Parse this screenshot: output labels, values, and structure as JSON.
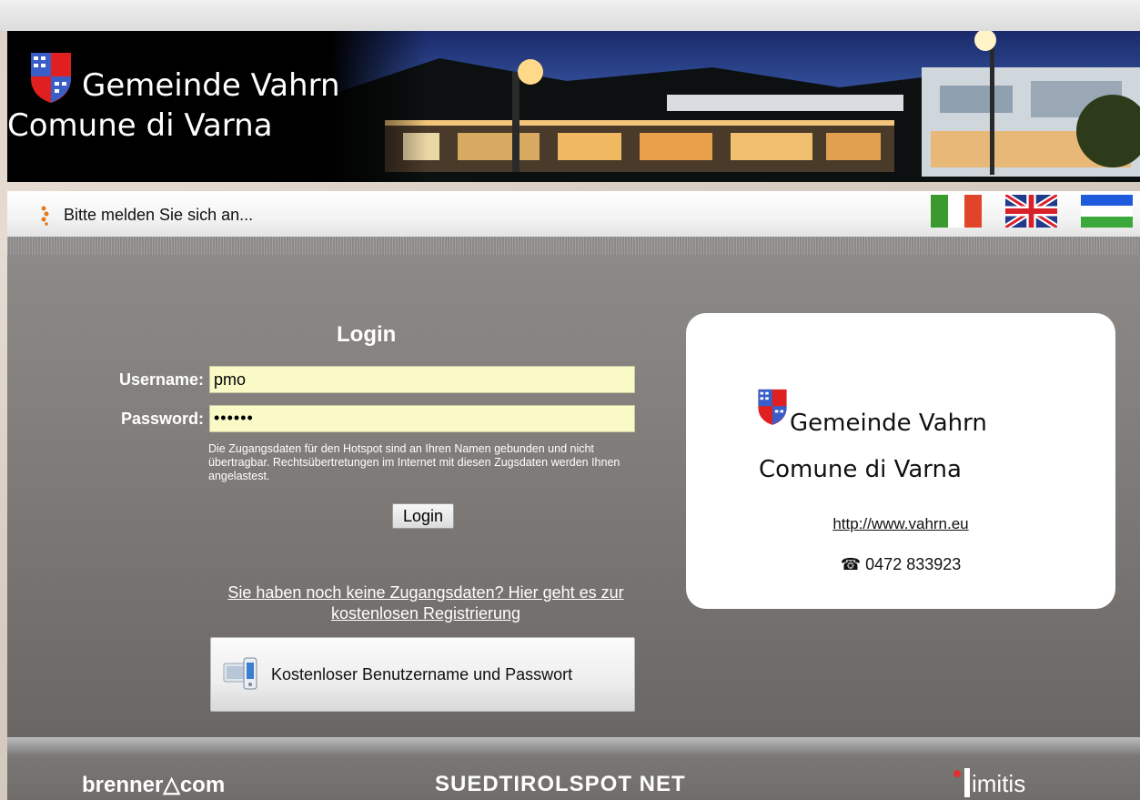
{
  "header": {
    "municipality_de": "Gemeinde Vahrn",
    "municipality_it": "Comune di Varna"
  },
  "status": {
    "message": "Bitte melden Sie sich an..."
  },
  "languages": [
    {
      "name": "italian-flag"
    },
    {
      "name": "uk-flag"
    },
    {
      "name": "local-flag"
    }
  ],
  "login": {
    "title": "Login",
    "username_label": "Username:",
    "username_value": "pmo",
    "password_label": "Password:",
    "password_value": "••••••",
    "hint": "Die Zugangsdaten für den Hotspot sind an Ihren Namen gebunden und nicht übertragbar. Rechtsübertretungen im Internet mit diesen Zugsdaten werden Ihnen angelastest.",
    "button_label": "Login",
    "register_link": "Sie haben noch keine Zugangsdaten? Hier geht es zur kostenlosen Registrierung",
    "free_button_label": "Kostenloser Benutzername und Passwort"
  },
  "card": {
    "name_de": "Gemeinde Vahrn",
    "name_it": "Comune di Varna",
    "url": "http://www.vahrn.eu",
    "phone": "☎ 0472 833923"
  },
  "footer": {
    "partner1": "brenner△com",
    "partner2": "SUEDTIROLSPOT NET",
    "partner3": "imitis"
  },
  "colors": {
    "header_bg": "#000000",
    "content_bg": "#7f7c79",
    "input_bg": "#fafac7",
    "card_bg": "#ffffff"
  }
}
